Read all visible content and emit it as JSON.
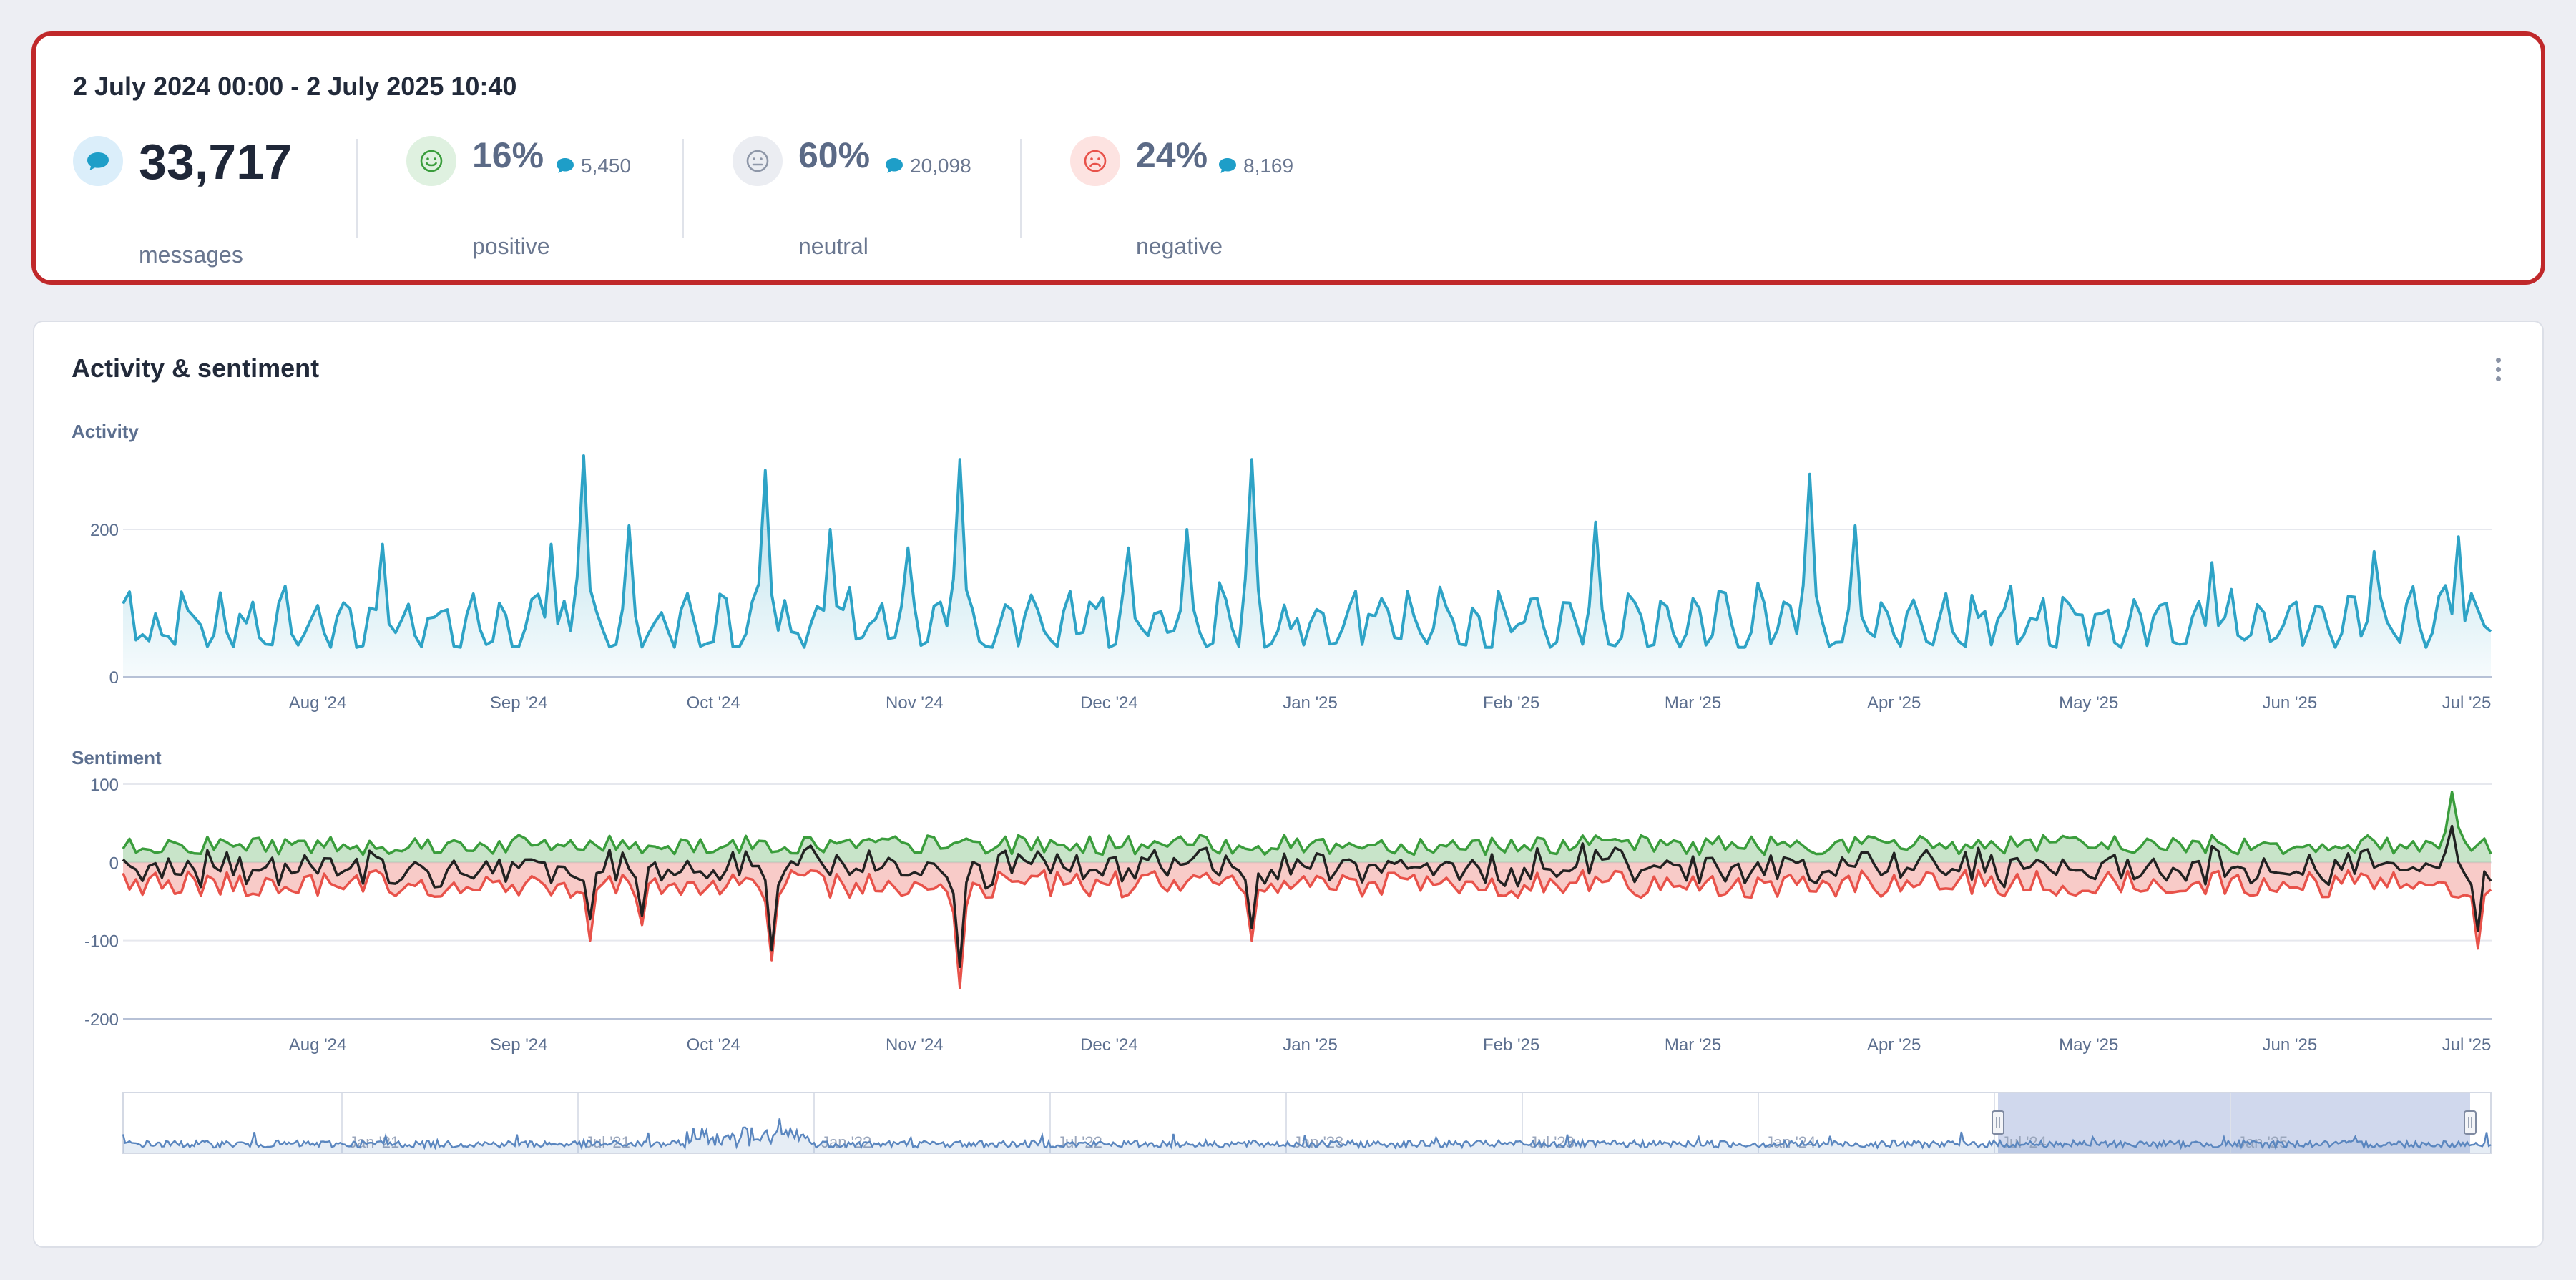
{
  "summary": {
    "date_range": "2 July 2024 00:00 - 2 July 2025 10:40",
    "messages": {
      "value": "33,717",
      "label": "messages",
      "icon": "chat-bubble-icon"
    },
    "positive": {
      "pct": "16%",
      "count": "5,450",
      "label": "positive",
      "icon": "smile-icon"
    },
    "neutral": {
      "pct": "60%",
      "count": "20,098",
      "label": "neutral",
      "icon": "neutral-face-icon"
    },
    "negative": {
      "pct": "24%",
      "count": "8,169",
      "label": "negative",
      "icon": "sad-face-icon"
    }
  },
  "panel": {
    "title": "Activity & sentiment",
    "menu_icon": "kebab-menu-icon"
  },
  "colors": {
    "activity_line": "#2ea3c6",
    "positive": "#3a9d3c",
    "negative": "#e8524a",
    "net": "#222222",
    "navigator_line": "#5a86bf",
    "navigator_selection": "#cdd6ec",
    "summary_border": "#c0282a"
  },
  "chart_data": [
    {
      "type": "area",
      "title": "Activity",
      "x_tick_labels": [
        "Aug '24",
        "Sep '24",
        "Oct '24",
        "Nov '24",
        "Dec '24",
        "Jan '25",
        "Feb '25",
        "Mar '25",
        "Apr '25",
        "May '25",
        "Jun '25",
        "Jul '25"
      ],
      "y_ticks": [
        0,
        200
      ],
      "ylim": [
        0,
        300
      ],
      "xlim": [
        "2024-07-02",
        "2025-07-02"
      ],
      "peaks": [
        {
          "date": "2024-07-20",
          "value": 85
        },
        {
          "date": "2024-08-11",
          "value": 180
        },
        {
          "date": "2024-09-06",
          "value": 180
        },
        {
          "date": "2024-09-11",
          "value": 300
        },
        {
          "date": "2024-09-18",
          "value": 205
        },
        {
          "date": "2024-10-09",
          "value": 280
        },
        {
          "date": "2024-10-19",
          "value": 200
        },
        {
          "date": "2024-10-31",
          "value": 175
        },
        {
          "date": "2024-11-08",
          "value": 295
        },
        {
          "date": "2024-12-04",
          "value": 175
        },
        {
          "date": "2024-12-13",
          "value": 200
        },
        {
          "date": "2024-12-23",
          "value": 295
        },
        {
          "date": "2025-02-14",
          "value": 210
        },
        {
          "date": "2025-03-19",
          "value": 275
        },
        {
          "date": "2025-03-26",
          "value": 205
        },
        {
          "date": "2025-05-20",
          "value": 155
        },
        {
          "date": "2025-06-14",
          "value": 170
        },
        {
          "date": "2025-06-27",
          "value": 190
        }
      ],
      "baseline_range": [
        40,
        130
      ]
    },
    {
      "type": "area",
      "title": "Sentiment",
      "x_tick_labels": [
        "Aug '24",
        "Sep '24",
        "Oct '24",
        "Nov '24",
        "Dec '24",
        "Jan '25",
        "Feb '25",
        "Mar '25",
        "Apr '25",
        "May '25",
        "Jun '25",
        "Jul '25"
      ],
      "y_ticks": [
        100,
        0,
        -100,
        -200
      ],
      "ylim": [
        -200,
        100
      ],
      "series": [
        {
          "role": "positive",
          "typical_range": [
            10,
            35
          ],
          "max": 90
        },
        {
          "role": "negative",
          "typical_range": [
            -45,
            -10
          ],
          "min": -160
        },
        {
          "role": "net",
          "typical_range": [
            -30,
            10
          ]
        }
      ],
      "negative_spikes": [
        {
          "date": "2024-09-12",
          "value": -100
        },
        {
          "date": "2024-09-20",
          "value": -80
        },
        {
          "date": "2024-10-10",
          "value": -125
        },
        {
          "date": "2024-11-08",
          "value": -160
        },
        {
          "date": "2024-12-23",
          "value": -100
        },
        {
          "date": "2025-06-30",
          "value": -110
        }
      ]
    },
    {
      "type": "area",
      "title": "",
      "role": "navigator",
      "x_tick_labels": [
        "Jan '21",
        "Jul '21",
        "Jan '22",
        "Jul '22",
        "Jan '23",
        "Jul '23",
        "Jan '24",
        "Jul '24",
        "Jan '25"
      ],
      "selection": {
        "from": "2024-07-02",
        "to": "2025-07-02"
      }
    }
  ]
}
